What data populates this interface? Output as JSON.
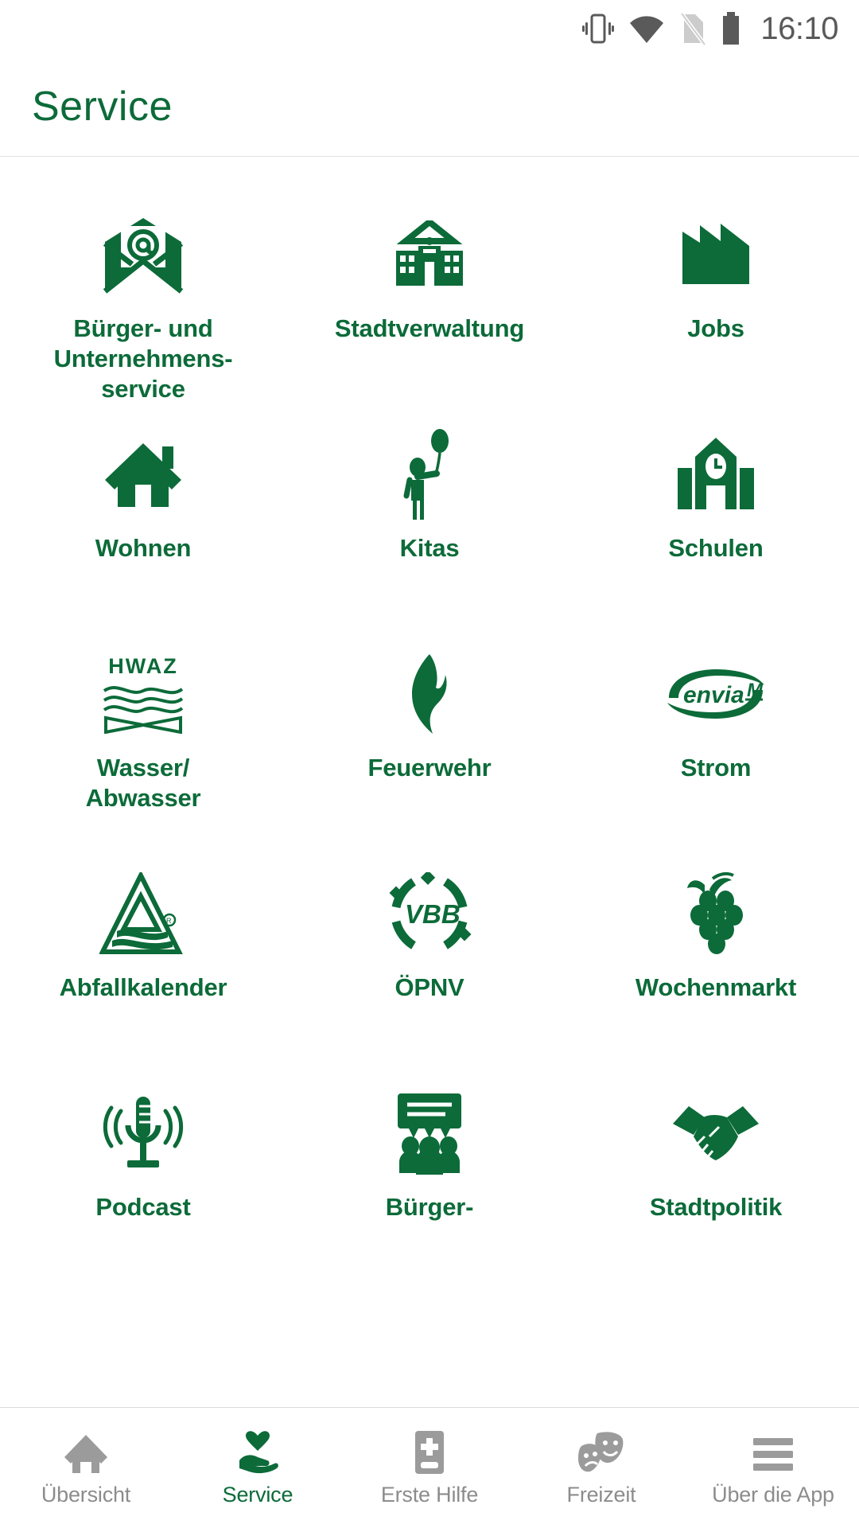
{
  "status_bar": {
    "time": "16:10",
    "icons": [
      "vibrate-icon",
      "wifi-icon",
      "sim-off-icon",
      "battery-icon"
    ]
  },
  "app_bar": {
    "title": "Service"
  },
  "colors": {
    "brand_green": "#0c6b39",
    "inactive_gray": "#8c8c8c",
    "background": "#ffffff"
  },
  "grid": {
    "tiles": [
      {
        "label": "Bürger- und\nUnternehmens-\nservice",
        "icon": "envelope-at-icon"
      },
      {
        "label": "Stadtverwaltung",
        "icon": "town-hall-icon"
      },
      {
        "label": "Jobs",
        "icon": "factory-icon"
      },
      {
        "label": "Wohnen",
        "icon": "house-icon"
      },
      {
        "label": "Kitas",
        "icon": "child-balloon-icon"
      },
      {
        "label": "Schulen",
        "icon": "school-clock-icon"
      },
      {
        "label": "Wasser/\nAbwasser",
        "icon": "hwaz-logo-icon"
      },
      {
        "label": "Feuerwehr",
        "icon": "flame-icon"
      },
      {
        "label": "Strom",
        "icon": "envia-m-logo-icon"
      },
      {
        "label": "Abfallkalender",
        "icon": "abfallkalender-logo-icon"
      },
      {
        "label": "ÖPNV",
        "icon": "vbb-logo-icon"
      },
      {
        "label": "Wochenmarkt",
        "icon": "grapes-icon"
      },
      {
        "label": "Podcast",
        "icon": "microphone-icon"
      },
      {
        "label": "Bürger-",
        "icon": "speech-people-icon"
      },
      {
        "label": "Stadtpolitik",
        "icon": "handshake-icon"
      }
    ],
    "hwaz_wordmark": "HWAZ",
    "envia_wordmark": "envia",
    "envia_suffix": "M",
    "vbb_wordmark": "VBB"
  },
  "bottom_nav": {
    "items": [
      {
        "label": "Übersicht",
        "icon": "home-icon",
        "active": false
      },
      {
        "label": "Service",
        "icon": "heart-hand-icon",
        "active": true
      },
      {
        "label": "Erste Hilfe",
        "icon": "first-aid-icon",
        "active": false
      },
      {
        "label": "Freizeit",
        "icon": "theater-masks-icon",
        "active": false
      },
      {
        "label": "Über die App",
        "icon": "hamburger-icon",
        "active": false
      }
    ]
  }
}
